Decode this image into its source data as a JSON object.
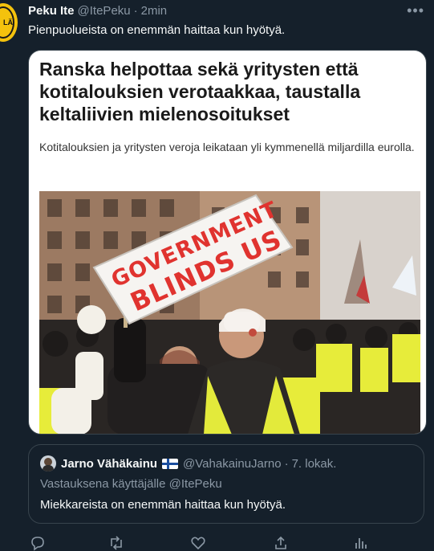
{
  "tweet": {
    "author_name": "Peku Ite",
    "author_handle": "@ItePeku",
    "separator": "·",
    "time": "2min",
    "text": "Pienpuolueista on enemmän haittaa kun hyötyä.",
    "avatar_text": "LÄ"
  },
  "card": {
    "title": "Ranska helpottaa sekä yritysten että kotitalouksien verotaakkaa, taustalla keltaliivien mielenosoitukset",
    "description": "Kotitalouksien ja yritysten veroja leikataan yli kymmenellä miljardilla eurolla.",
    "sign_line1": "GOVERNMENT",
    "sign_line2": "BLINDS US"
  },
  "quote": {
    "author_name": "Jarno Vähäkainu",
    "author_handle": "@VahakainuJarno",
    "separator": "·",
    "date": "7. lokak.",
    "reply_to": "Vastauksena käyttäjälle @ItePeku",
    "text": "Miekkareista on enemmän haittaa kun hyötyä."
  },
  "colors": {
    "background": "#15202b",
    "secondary_text": "#8b98a5",
    "border": "#38444d",
    "sign_red": "#e0332f"
  },
  "icons": [
    "more-icon",
    "reply-icon",
    "retweet-icon",
    "like-icon",
    "share-icon",
    "analytics-icon",
    "finland-flag-icon"
  ]
}
